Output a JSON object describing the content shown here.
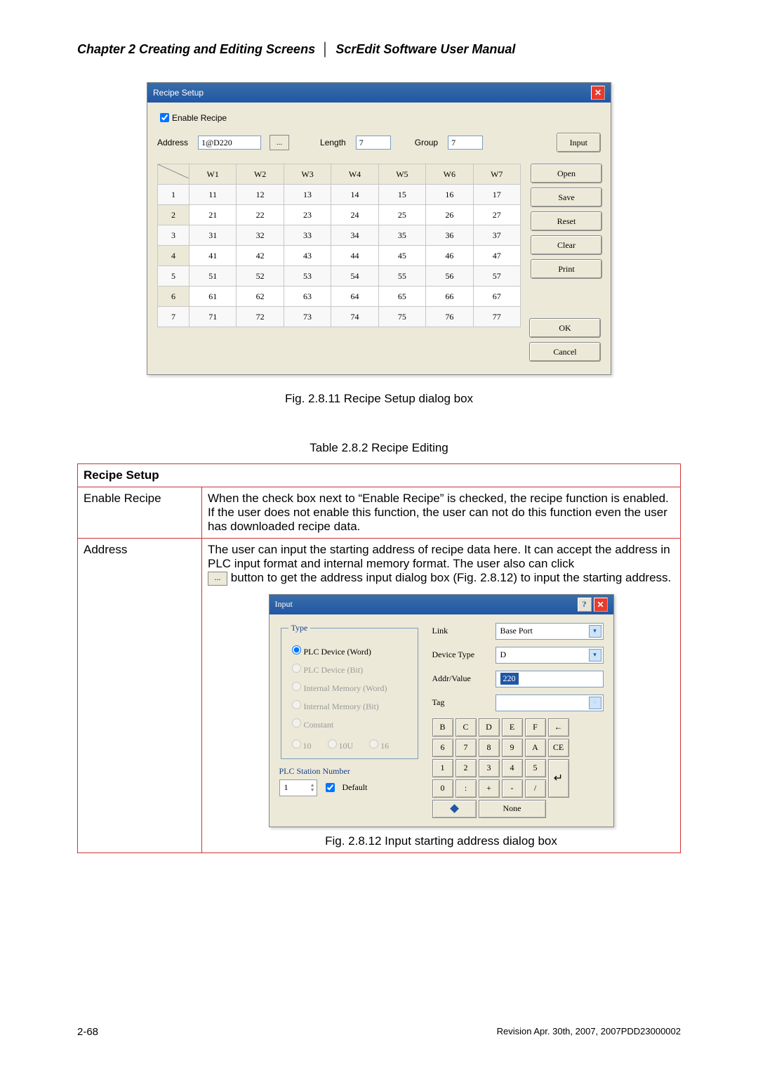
{
  "header": {
    "chapter": "Chapter 2  Creating and Editing Screens",
    "sep": "│",
    "product": "ScrEdit Software User Manual"
  },
  "dlg1": {
    "title": "Recipe Setup",
    "enable_label": "Enable Recipe",
    "address_label": "Address",
    "address_value": "1@D220",
    "length_label": "Length",
    "length_value": "7",
    "group_label": "Group",
    "group_value": "7",
    "input_btn": "Input",
    "side_btns": [
      "Open",
      "Save",
      "Reset",
      "Clear",
      "Print"
    ],
    "ok_btn": "OK",
    "cancel_btn": "Cancel",
    "columns": [
      "W1",
      "W2",
      "W3",
      "W4",
      "W5",
      "W6",
      "W7"
    ],
    "rows": [
      {
        "n": "1",
        "v": [
          "11",
          "12",
          "13",
          "14",
          "15",
          "16",
          "17"
        ]
      },
      {
        "n": "2",
        "v": [
          "21",
          "22",
          "23",
          "24",
          "25",
          "26",
          "27"
        ]
      },
      {
        "n": "3",
        "v": [
          "31",
          "32",
          "33",
          "34",
          "35",
          "36",
          "37"
        ]
      },
      {
        "n": "4",
        "v": [
          "41",
          "42",
          "43",
          "44",
          "45",
          "46",
          "47"
        ]
      },
      {
        "n": "5",
        "v": [
          "51",
          "52",
          "53",
          "54",
          "55",
          "56",
          "57"
        ]
      },
      {
        "n": "6",
        "v": [
          "61",
          "62",
          "63",
          "64",
          "65",
          "66",
          "67"
        ]
      },
      {
        "n": "7",
        "v": [
          "71",
          "72",
          "73",
          "74",
          "75",
          "76",
          "77"
        ]
      }
    ]
  },
  "fig1_caption": "Fig. 2.8.11 Recipe Setup dialog box",
  "table_caption": "Table 2.8.2 Recipe Editing",
  "desc": {
    "header": "Recipe Setup",
    "row1_label": "Enable Recipe",
    "row1_text": "When the check box next to “Enable Recipe” is checked, the recipe function is enabled. If the user does not enable this function, the user can not do this function even the user has downloaded recipe data.",
    "row2_label": "Address",
    "row2_text1": "The user can input the starting address of recipe data here. It can accept the address in PLC input format and internal memory format. The user also can click",
    "row2_text2": " button to get the address input dialog box (Fig. 2.8.12) to input the starting address."
  },
  "dlg2": {
    "title": "Input",
    "type_legend": "Type",
    "radios": [
      "PLC Device (Word)",
      "PLC Device (Bit)",
      "Internal Memory (Word)",
      "Internal Memory (Bit)",
      "Constant"
    ],
    "base": [
      "10",
      "10U",
      "16"
    ],
    "plc_legend": "PLC Station Number",
    "plc_value": "1",
    "default_label": "Default",
    "link_label": "Link",
    "link_value": "Base Port",
    "devtype_label": "Device Type",
    "devtype_value": "D",
    "addr_label": "Addr/Value",
    "addr_value": "220",
    "tag_label": "Tag",
    "tag_value": "",
    "keys_r1": [
      "B",
      "C",
      "D",
      "E",
      "F",
      "←"
    ],
    "keys_r2": [
      "6",
      "7",
      "8",
      "9",
      "A",
      "CE"
    ],
    "keys_r3": [
      "1",
      "2",
      "3",
      "4",
      "5"
    ],
    "keys_r4": [
      "0",
      ":",
      "+",
      "-",
      "/"
    ],
    "none_label": "None",
    "caption": "Fig. 2.8.12 Input starting address dialog box"
  },
  "footer": {
    "page": "2-68",
    "revision": "Revision Apr. 30th, 2007, 2007PDD23000002"
  }
}
